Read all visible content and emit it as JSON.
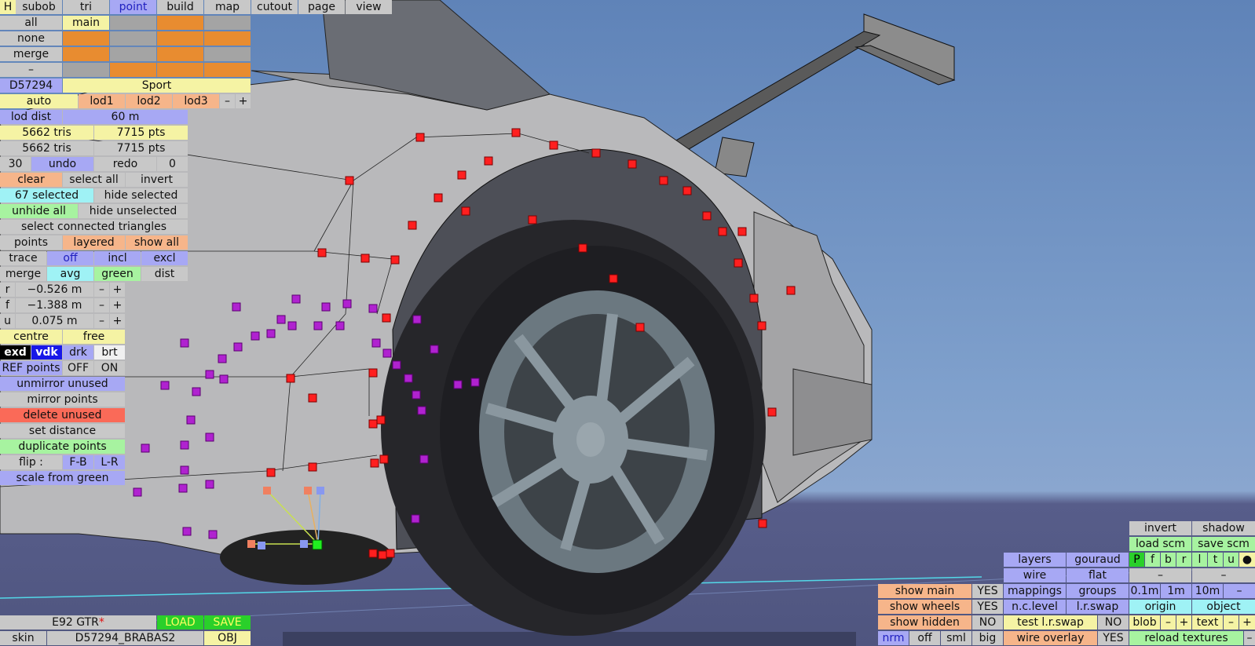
{
  "colors": {
    "accent_red": "#e01010",
    "grey": "#c8c8c8",
    "orange": "#e88c30",
    "blue": "#a7a8f4",
    "yellow": "#f5f3a4",
    "green": "#a7f3a0",
    "cyan": "#9ff2f5",
    "salmon": "#fa6a58",
    "bright_green": "#2ad02a"
  },
  "topbar": {
    "h": "H",
    "subob": "subob",
    "tri": "tri",
    "point": "point",
    "build": "build",
    "map": "map",
    "cutout": "cutout",
    "page": "page",
    "view": "view"
  },
  "rows": {
    "all": "all",
    "main": "main",
    "none": "none",
    "merge": "merge",
    "dash": "–"
  },
  "id": "D57294",
  "sport": "Sport",
  "lod": {
    "auto": "auto",
    "lod1": "lod1",
    "lod2": "lod2",
    "lod3": "lod3",
    "minus": "–",
    "plus": "+",
    "dist_label": "lod dist",
    "dist_value": "60 m"
  },
  "stats": {
    "tris1": "5662 tris",
    "pts1": "7715 pts",
    "tris2": "5662 tris",
    "pts2": "7715 pts"
  },
  "undo": {
    "count": "30",
    "undo": "undo",
    "redo": "redo",
    "redo_count": "0"
  },
  "sel": {
    "clear": "clear",
    "select_all": "select all",
    "invert": "invert",
    "selected": "67 selected",
    "hide_selected": "hide selected",
    "unhide_all": "unhide all",
    "hide_unselected": "hide unselected",
    "connected": "select connected triangles"
  },
  "pts": {
    "points": "points",
    "layered": "layered",
    "show_all": "show all",
    "trace": "trace",
    "off": "off",
    "incl": "incl",
    "excl": "excl",
    "merge": "merge",
    "avg": "avg",
    "green": "green",
    "dist": "dist"
  },
  "coords": [
    {
      "axis": "r",
      "value": "−0.526 m"
    },
    {
      "axis": "f",
      "value": "−1.388 m"
    },
    {
      "axis": "u",
      "value": "0.075 m"
    }
  ],
  "pm": {
    "minus": "–",
    "plus": "+"
  },
  "centre": {
    "centre": "centre",
    "free": "free"
  },
  "modes": {
    "exd": "exd",
    "vdk": "vdk",
    "drk": "drk",
    "brt": "brt"
  },
  "ref": {
    "label": "REF points",
    "off": "OFF",
    "on": "ON"
  },
  "ops": {
    "unmirror": "unmirror unused",
    "mirror": "mirror points",
    "delete": "delete unused",
    "set_distance": "set distance",
    "duplicate": "duplicate points",
    "flip": "flip :",
    "fb": "F-B",
    "lr": "L-R",
    "scale": "scale from green"
  },
  "file": {
    "name": "E92 GTR",
    "star": "*",
    "load": "LOAD",
    "save": "SAVE",
    "skin_label": "skin",
    "skin": "D57294_BRABAS2",
    "obj": "OBJ"
  },
  "bottom": {
    "show_main": "show main",
    "show_wheels": "show wheels",
    "show_hidden": "show hidden",
    "yes": "YES",
    "no": "NO",
    "nrm": "nrm",
    "off": "off",
    "sml": "sml",
    "big": "big",
    "layers": "layers",
    "gouraud": "gouraud",
    "wire": "wire",
    "flat": "flat",
    "mappings": "mappings",
    "groups": "groups",
    "nc_level": "n.c.level",
    "lr_swap": "l.r.swap",
    "test_lr_swap": "test l.r.swap",
    "wire_overlay": "wire overlay",
    "invert": "invert",
    "shadow": "shadow",
    "load_scm": "load scm",
    "save_scm": "save scm",
    "dash": "–",
    "d01": "0.1m",
    "d1": "1m",
    "d10": "10m",
    "origin": "origin",
    "object": "object",
    "blob": "blob",
    "minus": "–",
    "plus": "+",
    "text": "text",
    "reload": "reload textures"
  },
  "pfbr": [
    "P",
    "f",
    "b",
    "r",
    "l",
    "t",
    "u"
  ],
  "dot": "●"
}
